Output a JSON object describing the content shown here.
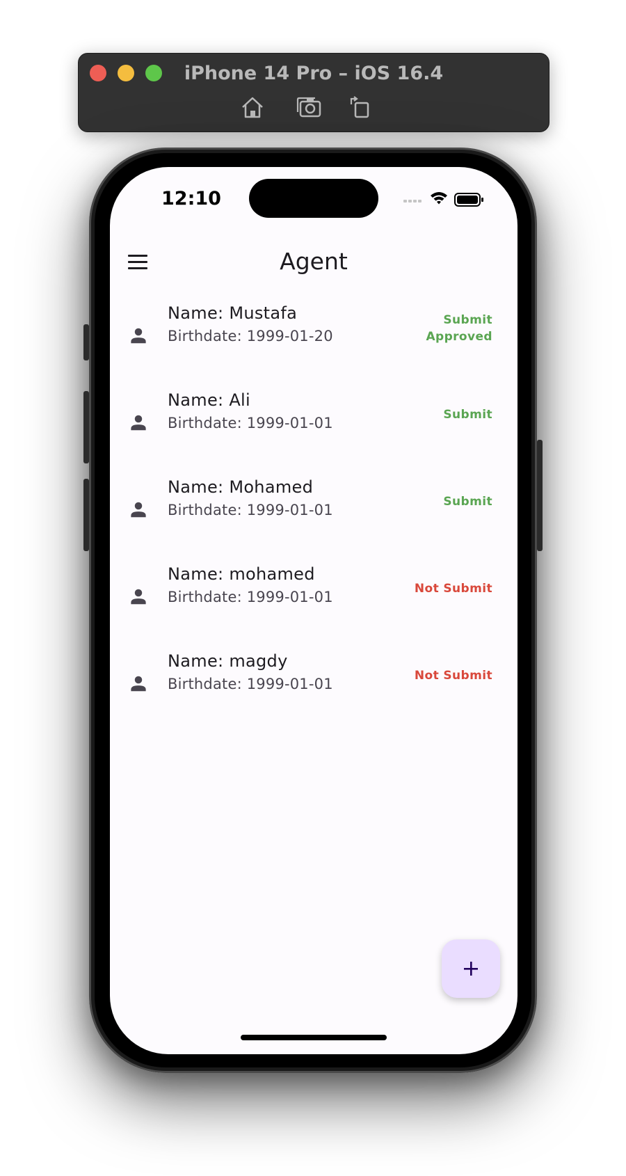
{
  "simulator": {
    "title": "iPhone 14 Pro – iOS 16.4",
    "tools": [
      "home-icon",
      "screenshot-icon",
      "rotate-icon"
    ]
  },
  "status_bar": {
    "time": "12:10"
  },
  "app_bar": {
    "title": "Agent",
    "menu_icon": "menu-icon"
  },
  "agents": [
    {
      "name": "Name: Mustafa",
      "birthdate": "Birthdate: 1999-01-20",
      "status": [
        "Submit",
        "Approved"
      ],
      "status_color": "#5aa552"
    },
    {
      "name": "Name: Ali",
      "birthdate": "Birthdate: 1999-01-01",
      "status": [
        "Submit"
      ],
      "status_color": "#5aa552"
    },
    {
      "name": "Name: Mohamed",
      "birthdate": "Birthdate: 1999-01-01",
      "status": [
        "Submit"
      ],
      "status_color": "#5aa552"
    },
    {
      "name": "Name: mohamed",
      "birthdate": "Birthdate: 1999-01-01",
      "status": [
        "Not Submit"
      ],
      "status_color": "#d9483b"
    },
    {
      "name": "Name: magdy",
      "birthdate": "Birthdate: 1999-01-01",
      "status": [
        "Not Submit"
      ],
      "status_color": "#d9483b"
    }
  ],
  "fab": {
    "icon": "add-icon",
    "label": "+"
  },
  "colors": {
    "screen_background": "#fdfbfe",
    "fab_background": "#eaddff",
    "submitted": "#5aa552",
    "not_submitted": "#d9483b"
  }
}
